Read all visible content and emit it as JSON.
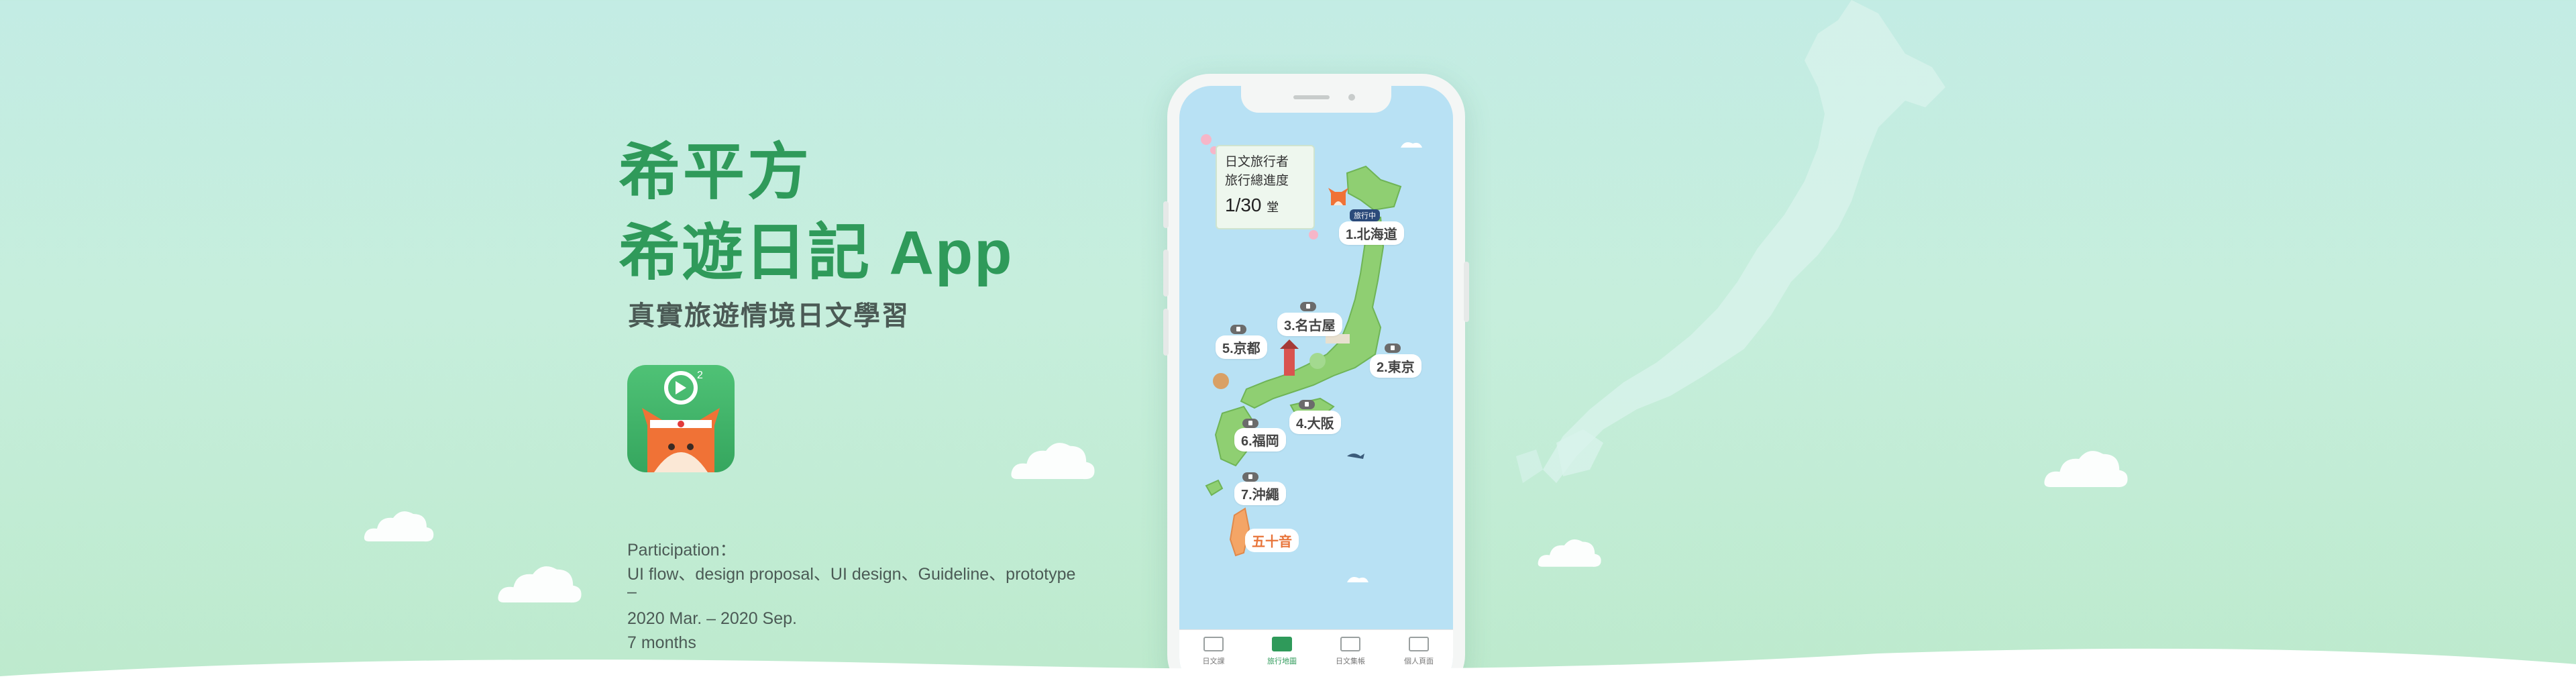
{
  "hero": {
    "title_line1": "希平方",
    "title_line2": "希遊日記 App",
    "subtitle": "真實旅遊情境日文學習"
  },
  "info": {
    "participation_label": "Participation：",
    "participation_items": "UI flow、design proposal、UI design、Guideline、prototype",
    "separator": "–",
    "period": "2020 Mar. – 2020 Sep.",
    "duration": "7 months"
  },
  "app": {
    "progress": {
      "line1": "日文旅行者",
      "line2": "旅行總進度",
      "count": "1/30",
      "unit": "堂"
    },
    "current_tag": "旅行中",
    "regions": [
      {
        "label": "1.北海道"
      },
      {
        "label": "2.東京"
      },
      {
        "label": "3.名古屋"
      },
      {
        "label": "4.大阪"
      },
      {
        "label": "5.京都"
      },
      {
        "label": "6.福岡"
      },
      {
        "label": "7.沖繩"
      }
    ],
    "gojuon": "五十音",
    "tabs": [
      {
        "label": "日文課",
        "icon": "torii-icon"
      },
      {
        "label": "旅行地圖",
        "icon": "map-icon"
      },
      {
        "label": "日文集帳",
        "icon": "notebook-icon"
      },
      {
        "label": "個人頁面",
        "icon": "profile-icon"
      }
    ],
    "active_tab": "旅行地圖"
  },
  "colors": {
    "brand_green": "#2f9a5a",
    "background_mint": "#c3ece4",
    "map_water": "#b8e1f4",
    "land_green": "#8fcf72",
    "accent_orange": "#e8743a"
  }
}
